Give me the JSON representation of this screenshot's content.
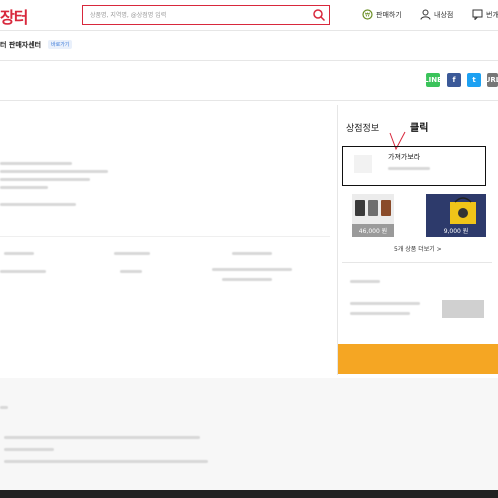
{
  "header": {
    "logo": "장터",
    "search_placeholder": "상품명, 지역명, @상점명 입력",
    "sell_label": "판매하기",
    "myshop_label": "내상점",
    "talk_label": "번개"
  },
  "subheader": {
    "title": "터 판매자센터",
    "badge": "바로가기"
  },
  "share": {
    "line": "LINE",
    "facebook": "f",
    "twitter": "t",
    "url": "URL"
  },
  "shop": {
    "title": "상점정보",
    "click_label": "클릭",
    "shop_name": "가져가보라",
    "products": [
      {
        "price": "46,000 원",
        "color": "#9a9a9a"
      },
      {
        "price": "9,000 원",
        "color": "#2d3a6b"
      }
    ],
    "more_link": "5개 상품 더보기 >"
  },
  "colors": {
    "brand": "#d8283c",
    "accent": "#f5a623"
  }
}
